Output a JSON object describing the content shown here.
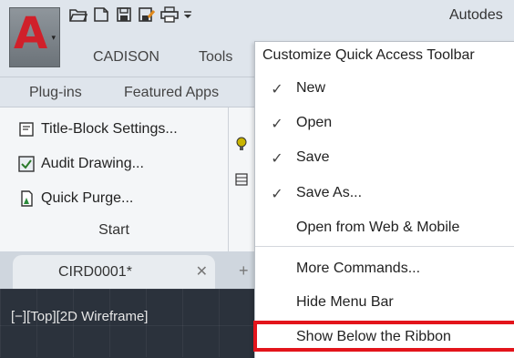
{
  "titlebar": {
    "app_title": "Autodes",
    "qat_icons": [
      "open-folder-icon",
      "new-file-icon",
      "save-icon",
      "save-as-icon",
      "print-icon",
      "customize-dropdown-icon"
    ]
  },
  "app_button": {
    "letter": "A",
    "caret": "▾"
  },
  "tabs": {
    "cadison": "CADISON",
    "tools": "Tools"
  },
  "tabs_row2": {
    "plugins": "Plug-ins",
    "featured": "Featured Apps"
  },
  "ribbon": {
    "items": [
      {
        "label": "Title-Block Settings...",
        "icon": "title-block-icon"
      },
      {
        "label": "Audit Drawing...",
        "icon": "audit-icon"
      },
      {
        "label": "Quick Purge...",
        "icon": "purge-icon"
      }
    ],
    "panel_label": "Start"
  },
  "file_tab": {
    "name": "CIRD0001*",
    "close": "✕",
    "new_tab": "+"
  },
  "viewport": {
    "label": "[−][Top][2D Wireframe]"
  },
  "menu": {
    "header": "Customize Quick Access Toolbar",
    "items": [
      {
        "label": "New",
        "check": "✓"
      },
      {
        "label": "Open",
        "check": "✓"
      },
      {
        "label": "Save",
        "check": "✓"
      },
      {
        "label": "Save As...",
        "check": "✓"
      },
      {
        "label": "Open from Web & Mobile",
        "check": ""
      },
      {
        "label": "More Commands...",
        "check": ""
      },
      {
        "label": "Hide Menu Bar",
        "check": ""
      },
      {
        "label": "Show Below the Ribbon",
        "check": ""
      }
    ]
  },
  "colors": {
    "accent_red": "#e3141b",
    "logo_red": "#d0202a"
  }
}
